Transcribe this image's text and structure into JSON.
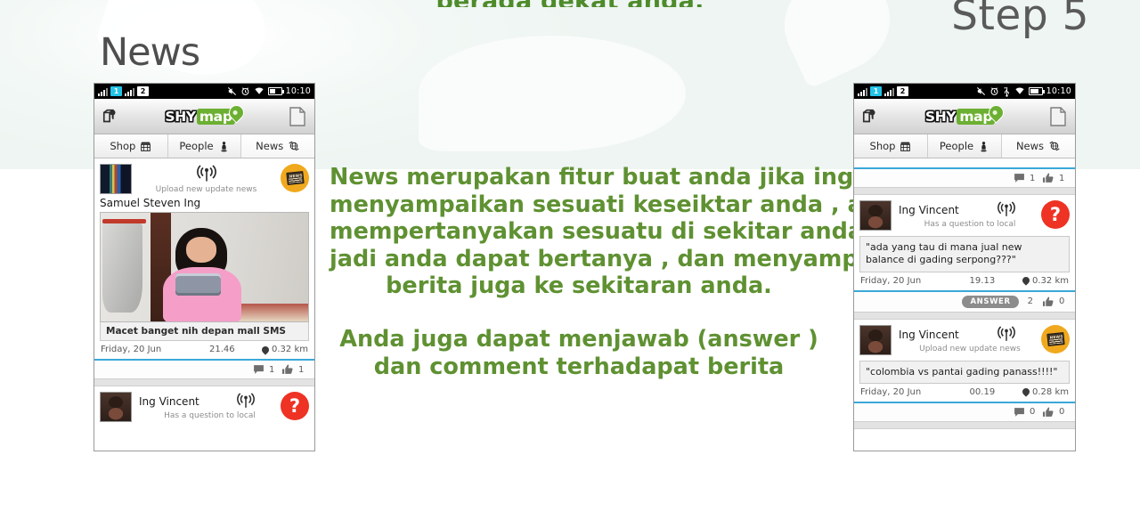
{
  "page": {
    "cut_off_heading": "berada dekat anda.",
    "section_title": "News",
    "step_label": "Step 5",
    "paragraph1": [
      "News merupakan fitur buat anda jika inging",
      "menyampaikan sesuati keseiktar anda , atau",
      "mempertanyakan sesuatu di sekitar anda",
      "jadi anda dapat bertanya , dan menyampaikan",
      "berita juga ke sekitaran anda."
    ],
    "paragraph2": [
      "Anda juga dapat menjawab (answer )",
      "dan comment terhadapat berita"
    ],
    "accent_green": "#5f9132",
    "accent_blue": "#3aa8d8",
    "badge_orange": "#f0a81e",
    "badge_red": "#ee3223"
  },
  "phone_left": {
    "statusbar": {
      "sim1": "1",
      "sim2": "2",
      "time": "10:10",
      "icons": [
        "signal-bars-icon",
        "sim1-badge-icon",
        "signal-bars-icon",
        "sim2-badge-icon",
        "mute-icon",
        "alarm-clock-icon",
        "wifi-icon",
        "battery-icon"
      ]
    },
    "header": {
      "left_icon": "map-pin-book-icon",
      "logo_shy": "SHY",
      "logo_map": "map",
      "right_icon": "note-page-icon"
    },
    "tabs": [
      {
        "label": "Shop",
        "icon": "store-icon",
        "active": false
      },
      {
        "label": "People",
        "icon": "person-icon",
        "active": false
      },
      {
        "label": "News",
        "icon": "globe-refresh-icon",
        "active": true
      }
    ],
    "posts": [
      {
        "type": "news-photo",
        "sub_label": "Upload new update news",
        "username": "Samuel Steven Ing",
        "badge": "news-badge-icon",
        "caption": "Macet banget nih depan mall SMS",
        "date": "Friday, 20 Jun",
        "time": "21.46",
        "distance": "0.32 km",
        "comments": "1",
        "likes": "1"
      },
      {
        "type": "question",
        "sub_label": "Has a question to local",
        "username": "Ing Vincent",
        "badge": "question-badge-icon"
      }
    ]
  },
  "phone_right": {
    "statusbar": {
      "sim1": "1",
      "sim2": "2",
      "time": "10:10",
      "icons": [
        "signal-bars-icon",
        "sim1-badge-icon",
        "signal-bars-icon",
        "sim2-badge-icon",
        "mute-icon",
        "alarm-clock-icon",
        "usb-icon",
        "wifi-icon",
        "battery-charging-icon"
      ]
    },
    "header": {
      "left_icon": "map-pin-book-icon",
      "logo_shy": "SHY",
      "logo_map": "map",
      "right_icon": "note-page-icon"
    },
    "tabs": [
      {
        "label": "Shop",
        "icon": "store-icon",
        "active": false
      },
      {
        "label": "People",
        "icon": "person-icon",
        "active": false
      },
      {
        "label": "News",
        "icon": "globe-refresh-icon",
        "active": true
      }
    ],
    "top_action": {
      "comments": "1",
      "likes": "1"
    },
    "posts": [
      {
        "type": "question",
        "sub_label": "Has a question to local",
        "username": "Ing Vincent",
        "badge": "question-badge-icon",
        "quote": "\"ada yang tau di mana jual new balance di gading serpong???\"",
        "date": "Friday, 20 Jun",
        "time": "19.13",
        "distance": "0.32 km",
        "answer_label": "ANSWER",
        "answers": "2",
        "likes": "0"
      },
      {
        "type": "news",
        "sub_label": "Upload new update news",
        "username": "Ing Vincent",
        "badge": "news-badge-icon",
        "quote": "\"colombia vs pantai gading panass!!!!\"",
        "date": "Friday, 20 Jun",
        "time": "00.19",
        "distance": "0.28 km",
        "comments": "0",
        "likes": "0"
      }
    ]
  }
}
